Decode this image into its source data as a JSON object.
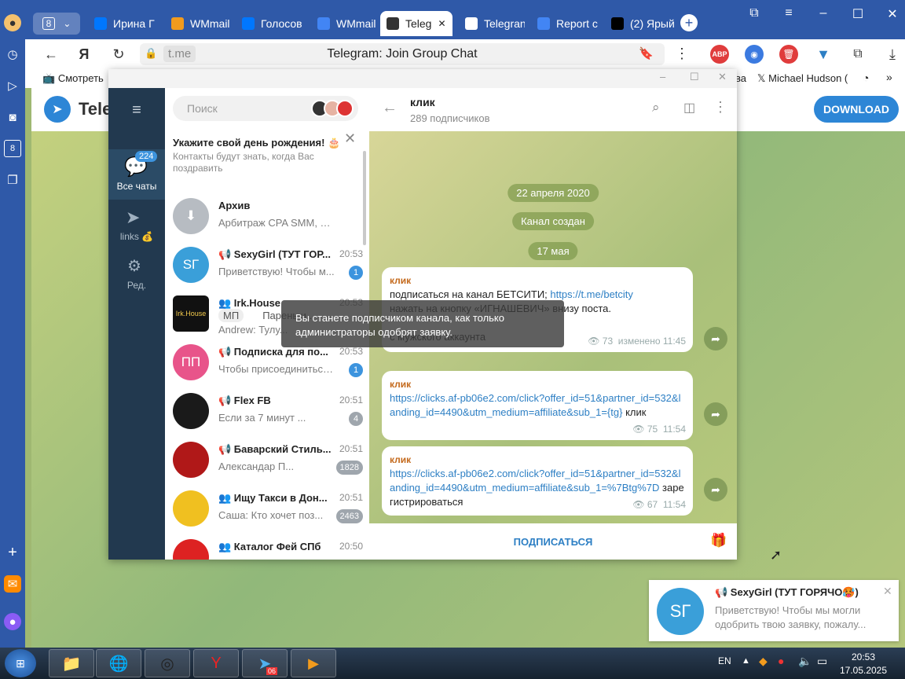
{
  "browser": {
    "tab_counter": "8",
    "tabs": [
      {
        "label": "Ирина Г",
        "icon": "vk-icon",
        "color": "#0077ff"
      },
      {
        "label": "WMmail",
        "icon": "wmmail-icon",
        "color": "#f29b1d"
      },
      {
        "label": "Голосов",
        "icon": "vk-icon",
        "color": "#0077ff"
      },
      {
        "label": "WMmail",
        "icon": "google-icon",
        "color": "#4285f4"
      },
      {
        "label": "Teleg",
        "icon": "page-icon",
        "color": "#333333"
      },
      {
        "label": "Telegran",
        "icon": "page-icon",
        "color": "#ffffff"
      },
      {
        "label": "Report c",
        "icon": "google-icon",
        "color": "#4285f4"
      },
      {
        "label": "(2) Ярый",
        "icon": "x-icon",
        "color": "#000000"
      }
    ],
    "domain": "t.me",
    "page_title": "Telegram: Join Group Chat",
    "bookmarks_left": "Смотреть",
    "bookmarks_right_1": "ва",
    "bookmarks_right_2": "Michael Hudson ("
  },
  "page": {
    "logo_text": "Teleg",
    "download_label": "DOWNLOAD"
  },
  "sidebar": {
    "all_chats_label": "Все чаты",
    "all_chats_count": "224",
    "links_label": "links 💰",
    "edit_label": "Ред."
  },
  "chatlist": {
    "search_placeholder": "Поиск",
    "birthday_title": "Укажите свой день рождения! 🎂",
    "birthday_text": "Контакты будут знать, когда Вас поздравить",
    "chats": [
      {
        "name": "Архив",
        "time": "",
        "preview": "Арбитраж CPA SMM, Кейсы ...",
        "badge": "",
        "avatar_text": "",
        "avatar_color": "#b7bcc2"
      },
      {
        "name": "📢 SexyGirl (ТУТ ГОР...",
        "time": "20:53",
        "preview": "Приветствую! Чтобы м...",
        "badge": "1",
        "avatar_text": "SГ",
        "avatar_color": "#3a9fd9"
      },
      {
        "name": "👥 Irk.House",
        "time": "20:53",
        "preview": "Andrew: Тулу...",
        "badge": "",
        "avatar_text": "Irk.House",
        "avatar_color": "#111111"
      },
      {
        "name": "📢 Подписка для по...",
        "time": "20:53",
        "preview": "Чтобы присоединиться...",
        "badge": "1",
        "avatar_text": "ПП",
        "avatar_color": "#e8548a"
      },
      {
        "name": "📢 Flex FB",
        "time": "20:51",
        "preview": "Если за 7 минут ...",
        "badge": "4",
        "avatar_text": "",
        "avatar_color": "#1a1a1a"
      },
      {
        "name": "📢 Баварский Стиль...",
        "time": "20:51",
        "preview": "Александар П...",
        "badge": "1828",
        "avatar_text": "",
        "avatar_color": "#b01818"
      },
      {
        "name": "👥 Ищу Такси в Дон...",
        "time": "20:51",
        "preview": "Саша: Кто хочет поз...",
        "badge": "2463",
        "avatar_text": "",
        "avatar_color": "#f0c020"
      },
      {
        "name": "👥 Каталог Фей СПб",
        "time": "20:50",
        "preview": "",
        "badge": "",
        "avatar_text": "",
        "avatar_color": "#d22"
      }
    ],
    "irk_sub_1": "МП",
    "irk_sub_2": "Парень и..."
  },
  "channel": {
    "name": "клик",
    "subscribers": "289 подписчиков",
    "date_1": "22 апреля 2020",
    "created": "Канал создан",
    "date_2": "17 мая",
    "messages": [
      {
        "sender": "клик",
        "line1": "подписаться  на канал БЕТСИТИ;  ",
        "link1": "https://t.me/betcity",
        "line2": " нажать на кнопку «ИГНАШЕВИЧ» внизу поста.",
        "line3": "с  мужского аккаунта",
        "views": "73",
        "time": "изменено 11:45"
      },
      {
        "sender": "клик",
        "link": "https://clicks.af-pb06e2.com/click?offer_id=51&partner_id=532&landing_id=4490&utm_medium=affiliate&sub_1={tg}",
        "after": " клик",
        "views": "75",
        "time": "11:54"
      },
      {
        "sender": "клик",
        "link": "https://clicks.af-pb06e2.com/click?offer_id=51&partner_id=532&landing_id=4490&utm_medium=affiliate&sub_1=%7Btg%7D",
        "after": " зарегистрироваться",
        "views": "67",
        "time": "11:54"
      }
    ],
    "subscribe_label": "ПОДПИСАТЬСЯ",
    "tooltip": "Вы станете подписчиком канала, как только администраторы одобрят заявку."
  },
  "notification": {
    "avatar_text": "SГ",
    "title": "📢 SexyGirl (ТУТ ГОРЯЧО🥵)",
    "text": "Приветствую! Чтобы мы могли одобрить твою заявку, пожалу..."
  },
  "taskbar": {
    "lang": "EN",
    "time": "20:53",
    "date": "17.05.2025",
    "tg_badge": "06"
  }
}
